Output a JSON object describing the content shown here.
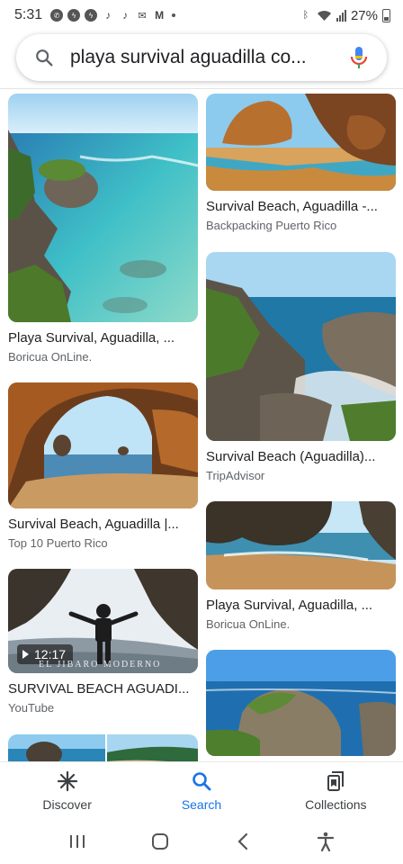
{
  "status_bar": {
    "time": "5:31",
    "battery": "27%",
    "app_icons": [
      "whatsapp-icon",
      "messenger-icon",
      "messenger-icon",
      "tiktok-icon",
      "tiktok-icon",
      "mail-icon",
      "gmail-icon",
      "more-dot-icon"
    ],
    "system_icons": [
      "bluetooth-icon",
      "wifi-icon",
      "signal-icon",
      "battery-icon"
    ]
  },
  "search": {
    "query": "playa survival aguadilla co...",
    "icon": "search-icon",
    "voice_icon": "mic-icon"
  },
  "results": [
    {
      "title": "Playa Survival, Aguadilla, ...",
      "source": "Boricua OnLine."
    },
    {
      "title": "Survival Beach, Aguadilla -...",
      "source": "Backpacking Puerto Rico"
    },
    {
      "title": "Survival Beach (Aguadilla)...",
      "source": "TripAdvisor"
    },
    {
      "title": "Survival Beach, Aguadilla |...",
      "source": "Top 10 Puerto Rico"
    },
    {
      "title": "Playa Survival, Aguadilla, ...",
      "source": "Boricua OnLine."
    },
    {
      "title": "SURVIVAL BEACH AGUADI...",
      "source": "YouTube",
      "video_duration": "12:17",
      "watermark": "EL JIBARO MODERNO"
    },
    {
      "title": "",
      "source": ""
    },
    {
      "title": "",
      "source": ""
    }
  ],
  "bottom_nav": {
    "items": [
      {
        "label": "Discover",
        "icon": "discover-icon",
        "active": false
      },
      {
        "label": "Search",
        "icon": "search-icon",
        "active": true
      },
      {
        "label": "Collections",
        "icon": "collections-icon",
        "active": false
      }
    ]
  },
  "system_nav": {
    "buttons": [
      "recent-apps-icon",
      "home-icon",
      "back-icon",
      "accessibility-icon"
    ]
  },
  "colors": {
    "accent": "#1a73e8",
    "text_primary": "#202124",
    "text_secondary": "#5f6368"
  }
}
